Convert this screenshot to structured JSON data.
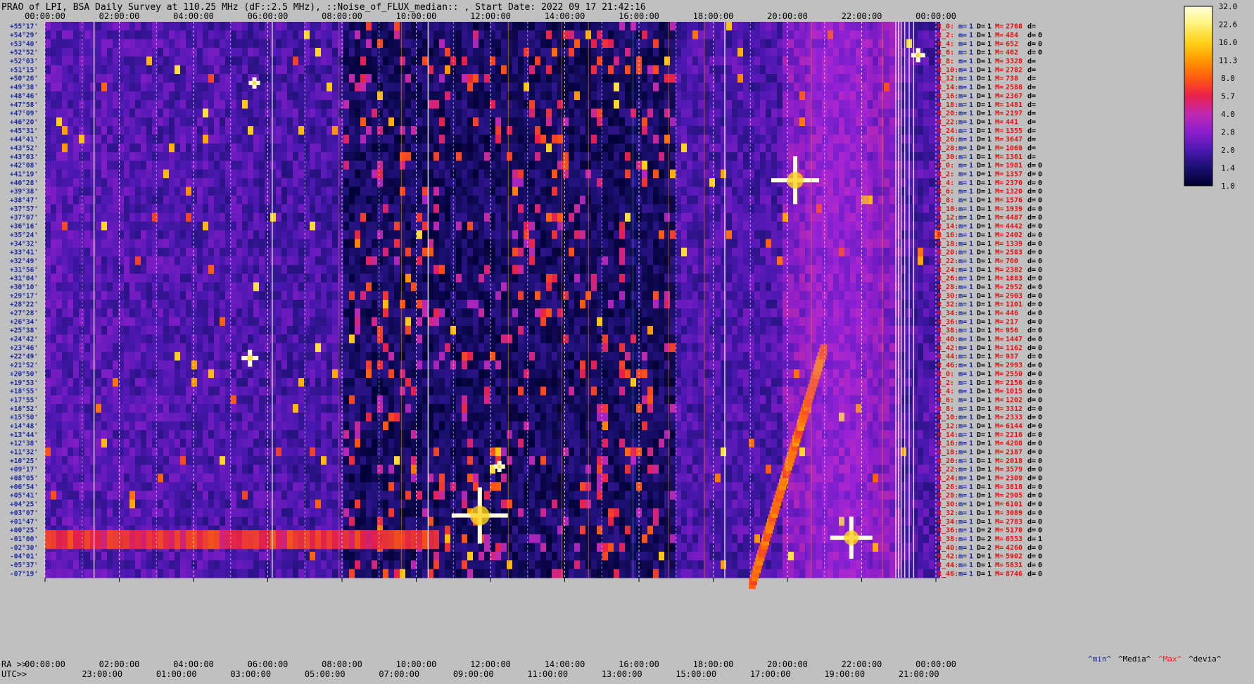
{
  "title": "PRAO of LPI, BSA Daily Survey at 110.25 MHz (dF::2.5 MHz), ::Noise_of_FLUX_median:: , Start Date: 2022 09 17 21:42:16",
  "chart_data": {
    "type": "heatmap",
    "title": "PRAO of LPI, BSA Daily Survey at 110.25 MHz (dF::2.5 MHz), ::Noise_of_FLUX_median:: , Start Date: 2022 09 17 21:42:16",
    "x_top_ticks": [
      "00:00:00",
      "02:00:00",
      "04:00:00",
      "06:00:00",
      "08:00:00",
      "10:00:00",
      "12:00:00",
      "14:00:00",
      "16:00:00",
      "18:00:00",
      "20:00:00",
      "22:00:00",
      "00:00:00"
    ],
    "ra_label": "RA >>",
    "ra_ticks": [
      "00:00:00",
      "02:00:00",
      "04:00:00",
      "06:00:00",
      "08:00:00",
      "10:00:00",
      "12:00:00",
      "14:00:00",
      "16:00:00",
      "18:00:00",
      "20:00:00",
      "22:00:00",
      "00:00:00"
    ],
    "utc_label": "UTC>>",
    "utc_ticks": [
      "23:00:00",
      "01:00:00",
      "03:00:00",
      "05:00:00",
      "07:00:00",
      "09:00:00",
      "11:00:00",
      "13:00:00",
      "15:00:00",
      "17:00:00",
      "19:00:00",
      "21:00:00"
    ],
    "declinations": [
      "+55°17'",
      "+54°29'",
      "+53°40'",
      "+52°52'",
      "+52°03'",
      "+51°15'",
      "+50°26'",
      "+49°38'",
      "+48°46'",
      "+47°58'",
      "+47°09'",
      "+46°20'",
      "+45°31'",
      "+44°41'",
      "+43°52'",
      "+43°03'",
      "+42°08'",
      "+41°19'",
      "+40°28'",
      "+39°38'",
      "+38°47'",
      "+37°57'",
      "+37°07'",
      "+36°16'",
      "+35°24'",
      "+34°32'",
      "+33°41'",
      "+32°49'",
      "+31°56'",
      "+31°04'",
      "+30°10'",
      "+29°17'",
      "+28°22'",
      "+27°28'",
      "+26°34'",
      "+25°38'",
      "+24°42'",
      "+23°46'",
      "+22°49'",
      "+21°52'",
      "+20°50'",
      "+19°53'",
      "+18°55'",
      "+17°55'",
      "+16°52'",
      "+15°50'",
      "+14°48'",
      "+13°44'",
      "+12°38'",
      "+11°32'",
      "+10°25'",
      "+09°17'",
      "+08°05'",
      "+06°54'",
      "+05°41'",
      "+04°25'",
      "+03°07'",
      "+01°47'",
      "+00°25'",
      "-01°00'",
      "-02°30'",
      "-04°01'",
      "-05°37'",
      "-07°19'"
    ],
    "colorbar": {
      "ticks": [
        "32.0",
        "22.6",
        "16.0",
        "11.3",
        "8.0",
        "5.7",
        "4.0",
        "2.8",
        "2.0",
        "1.4",
        "1.0"
      ],
      "range": [
        1.0,
        32.0
      ],
      "scale": "log",
      "colors": [
        "#000030",
        "#1a1070",
        "#4b18b0",
        "#8a1ecc",
        "#c02ab0",
        "#e8204a",
        "#ff5a10",
        "#ff9a00",
        "#ffd21a",
        "#fff27a",
        "#ffffe0"
      ]
    },
    "legend": [
      {
        "text": "^min^",
        "color": "#1c2aa0"
      },
      {
        "text": "^Media^",
        "color": "#000000"
      },
      {
        "text": "^Max^",
        "color": "#ff2020"
      },
      {
        "text": "^devia^",
        "color": "#000000"
      }
    ],
    "right_stats": [
      {
        "r": "R_0:",
        "m": "1",
        "D": "1",
        "M": "2768",
        "d": ""
      },
      {
        "r": "R_2:",
        "m": "1",
        "D": "1",
        "M": "484",
        "d": "0"
      },
      {
        "r": "R_4:",
        "m": "1",
        "D": "1",
        "M": "652",
        "d": "0"
      },
      {
        "r": "R_6:",
        "m": "1",
        "D": "1",
        "M": "462",
        "d": "0"
      },
      {
        "r": "R_8:",
        "m": "1",
        "D": "1",
        "M": "3328",
        "d": ""
      },
      {
        "r": "R_10:",
        "m": "1",
        "D": "1",
        "M": "2782",
        "d": ""
      },
      {
        "r": "R_12:",
        "m": "1",
        "D": "1",
        "M": "738",
        "d": ""
      },
      {
        "r": "R_14:",
        "m": "1",
        "D": "1",
        "M": "2588",
        "d": ""
      },
      {
        "r": "R_16:",
        "m": "1",
        "D": "1",
        "M": "2367",
        "d": ""
      },
      {
        "r": "R_18:",
        "m": "1",
        "D": "1",
        "M": "1481",
        "d": ""
      },
      {
        "r": "R_20:",
        "m": "1",
        "D": "1",
        "M": "2197",
        "d": ""
      },
      {
        "r": "R_22:",
        "m": "1",
        "D": "1",
        "M": "441",
        "d": ""
      },
      {
        "r": "R_24:",
        "m": "1",
        "D": "1",
        "M": "1355",
        "d": ""
      },
      {
        "r": "R_26:",
        "m": "1",
        "D": "1",
        "M": "3647",
        "d": ""
      },
      {
        "r": "R_28:",
        "m": "1",
        "D": "1",
        "M": "1069",
        "d": ""
      },
      {
        "r": "R_30:",
        "m": "1",
        "D": "1",
        "M": "1361",
        "d": ""
      },
      {
        "r": "R_0:",
        "m": "1",
        "D": "1",
        "M": "1981",
        "d": "0"
      },
      {
        "r": "R_2:",
        "m": "1",
        "D": "1",
        "M": "1357",
        "d": "0"
      },
      {
        "r": "R_4:",
        "m": "1",
        "D": "1",
        "M": "2370",
        "d": "0"
      },
      {
        "r": "R_6:",
        "m": "1",
        "D": "1",
        "M": "1320",
        "d": "0"
      },
      {
        "r": "R_8:",
        "m": "1",
        "D": "1",
        "M": "1576",
        "d": "0"
      },
      {
        "r": "R_10:",
        "m": "1",
        "D": "1",
        "M": "1939",
        "d": "0"
      },
      {
        "r": "R_12:",
        "m": "1",
        "D": "1",
        "M": "4487",
        "d": "0"
      },
      {
        "r": "R_14:",
        "m": "1",
        "D": "1",
        "M": "4442",
        "d": "0"
      },
      {
        "r": "R_16:",
        "m": "1",
        "D": "1",
        "M": "2402",
        "d": "0"
      },
      {
        "r": "R_18:",
        "m": "1",
        "D": "1",
        "M": "1339",
        "d": "0"
      },
      {
        "r": "R_20:",
        "m": "1",
        "D": "1",
        "M": "2583",
        "d": "0"
      },
      {
        "r": "R_22:",
        "m": "1",
        "D": "1",
        "M": "700",
        "d": "0"
      },
      {
        "r": "R_24:",
        "m": "1",
        "D": "1",
        "M": "2382",
        "d": "0"
      },
      {
        "r": "R_26:",
        "m": "1",
        "D": "1",
        "M": "1883",
        "d": "0"
      },
      {
        "r": "R_28:",
        "m": "1",
        "D": "1",
        "M": "2952",
        "d": "0"
      },
      {
        "r": "R_30:",
        "m": "1",
        "D": "1",
        "M": "2903",
        "d": "0"
      },
      {
        "r": "R_32:",
        "m": "1",
        "D": "1",
        "M": "1101",
        "d": "0"
      },
      {
        "r": "R_34:",
        "m": "1",
        "D": "1",
        "M": "446",
        "d": "0"
      },
      {
        "r": "R_36:",
        "m": "1",
        "D": "1",
        "M": "217",
        "d": "0"
      },
      {
        "r": "R_38:",
        "m": "1",
        "D": "1",
        "M": "956",
        "d": "0"
      },
      {
        "r": "R_40:",
        "m": "1",
        "D": "1",
        "M": "1447",
        "d": "0"
      },
      {
        "r": "R_42:",
        "m": "1",
        "D": "1",
        "M": "1162",
        "d": "0"
      },
      {
        "r": "R_44:",
        "m": "1",
        "D": "1",
        "M": "937",
        "d": "0"
      },
      {
        "r": "R_46:",
        "m": "1",
        "D": "1",
        "M": "2993",
        "d": "0"
      },
      {
        "r": "R_0:",
        "m": "1",
        "D": "1",
        "M": "2550",
        "d": "0"
      },
      {
        "r": "R_2:",
        "m": "1",
        "D": "1",
        "M": "2156",
        "d": "0"
      },
      {
        "r": "R_4:",
        "m": "1",
        "D": "1",
        "M": "1015",
        "d": "0"
      },
      {
        "r": "R_6:",
        "m": "1",
        "D": "1",
        "M": "1202",
        "d": "0"
      },
      {
        "r": "R_8:",
        "m": "1",
        "D": "1",
        "M": "3312",
        "d": "0"
      },
      {
        "r": "R_10:",
        "m": "1",
        "D": "1",
        "M": "2333",
        "d": "0"
      },
      {
        "r": "R_12:",
        "m": "1",
        "D": "1",
        "M": "6144",
        "d": "0"
      },
      {
        "r": "R_14:",
        "m": "1",
        "D": "1",
        "M": "2216",
        "d": "0"
      },
      {
        "r": "R_16:",
        "m": "1",
        "D": "1",
        "M": "4208",
        "d": "0"
      },
      {
        "r": "R_18:",
        "m": "1",
        "D": "1",
        "M": "2187",
        "d": "0"
      },
      {
        "r": "R_20:",
        "m": "1",
        "D": "1",
        "M": "2018",
        "d": "0"
      },
      {
        "r": "R_22:",
        "m": "1",
        "D": "1",
        "M": "3579",
        "d": "0"
      },
      {
        "r": "R_24:",
        "m": "1",
        "D": "1",
        "M": "2309",
        "d": "0"
      },
      {
        "r": "R_26:",
        "m": "1",
        "D": "1",
        "M": "3818",
        "d": "0"
      },
      {
        "r": "R_28:",
        "m": "1",
        "D": "1",
        "M": "2905",
        "d": "0"
      },
      {
        "r": "R_30:",
        "m": "1",
        "D": "1",
        "M": "6101",
        "d": "0"
      },
      {
        "r": "R_32:",
        "m": "1",
        "D": "1",
        "M": "3089",
        "d": "0"
      },
      {
        "r": "R_34:",
        "m": "1",
        "D": "1",
        "M": "2783",
        "d": "0"
      },
      {
        "r": "R_36:",
        "m": "1",
        "D": "2",
        "M": "5170",
        "d": "0"
      },
      {
        "r": "R_38:",
        "m": "1",
        "D": "2",
        "M": "6553",
        "d": "1"
      },
      {
        "r": "R_40:",
        "m": "1",
        "D": "2",
        "M": "4260",
        "d": "0"
      },
      {
        "r": "R_42:",
        "m": "1",
        "D": "1",
        "M": "5902",
        "d": "0"
      },
      {
        "r": "R_44:",
        "m": "1",
        "D": "1",
        "M": "5831",
        "d": "0"
      },
      {
        "r": "R_46:",
        "m": "1",
        "D": "1",
        "M": "8746",
        "d": "0"
      }
    ]
  }
}
